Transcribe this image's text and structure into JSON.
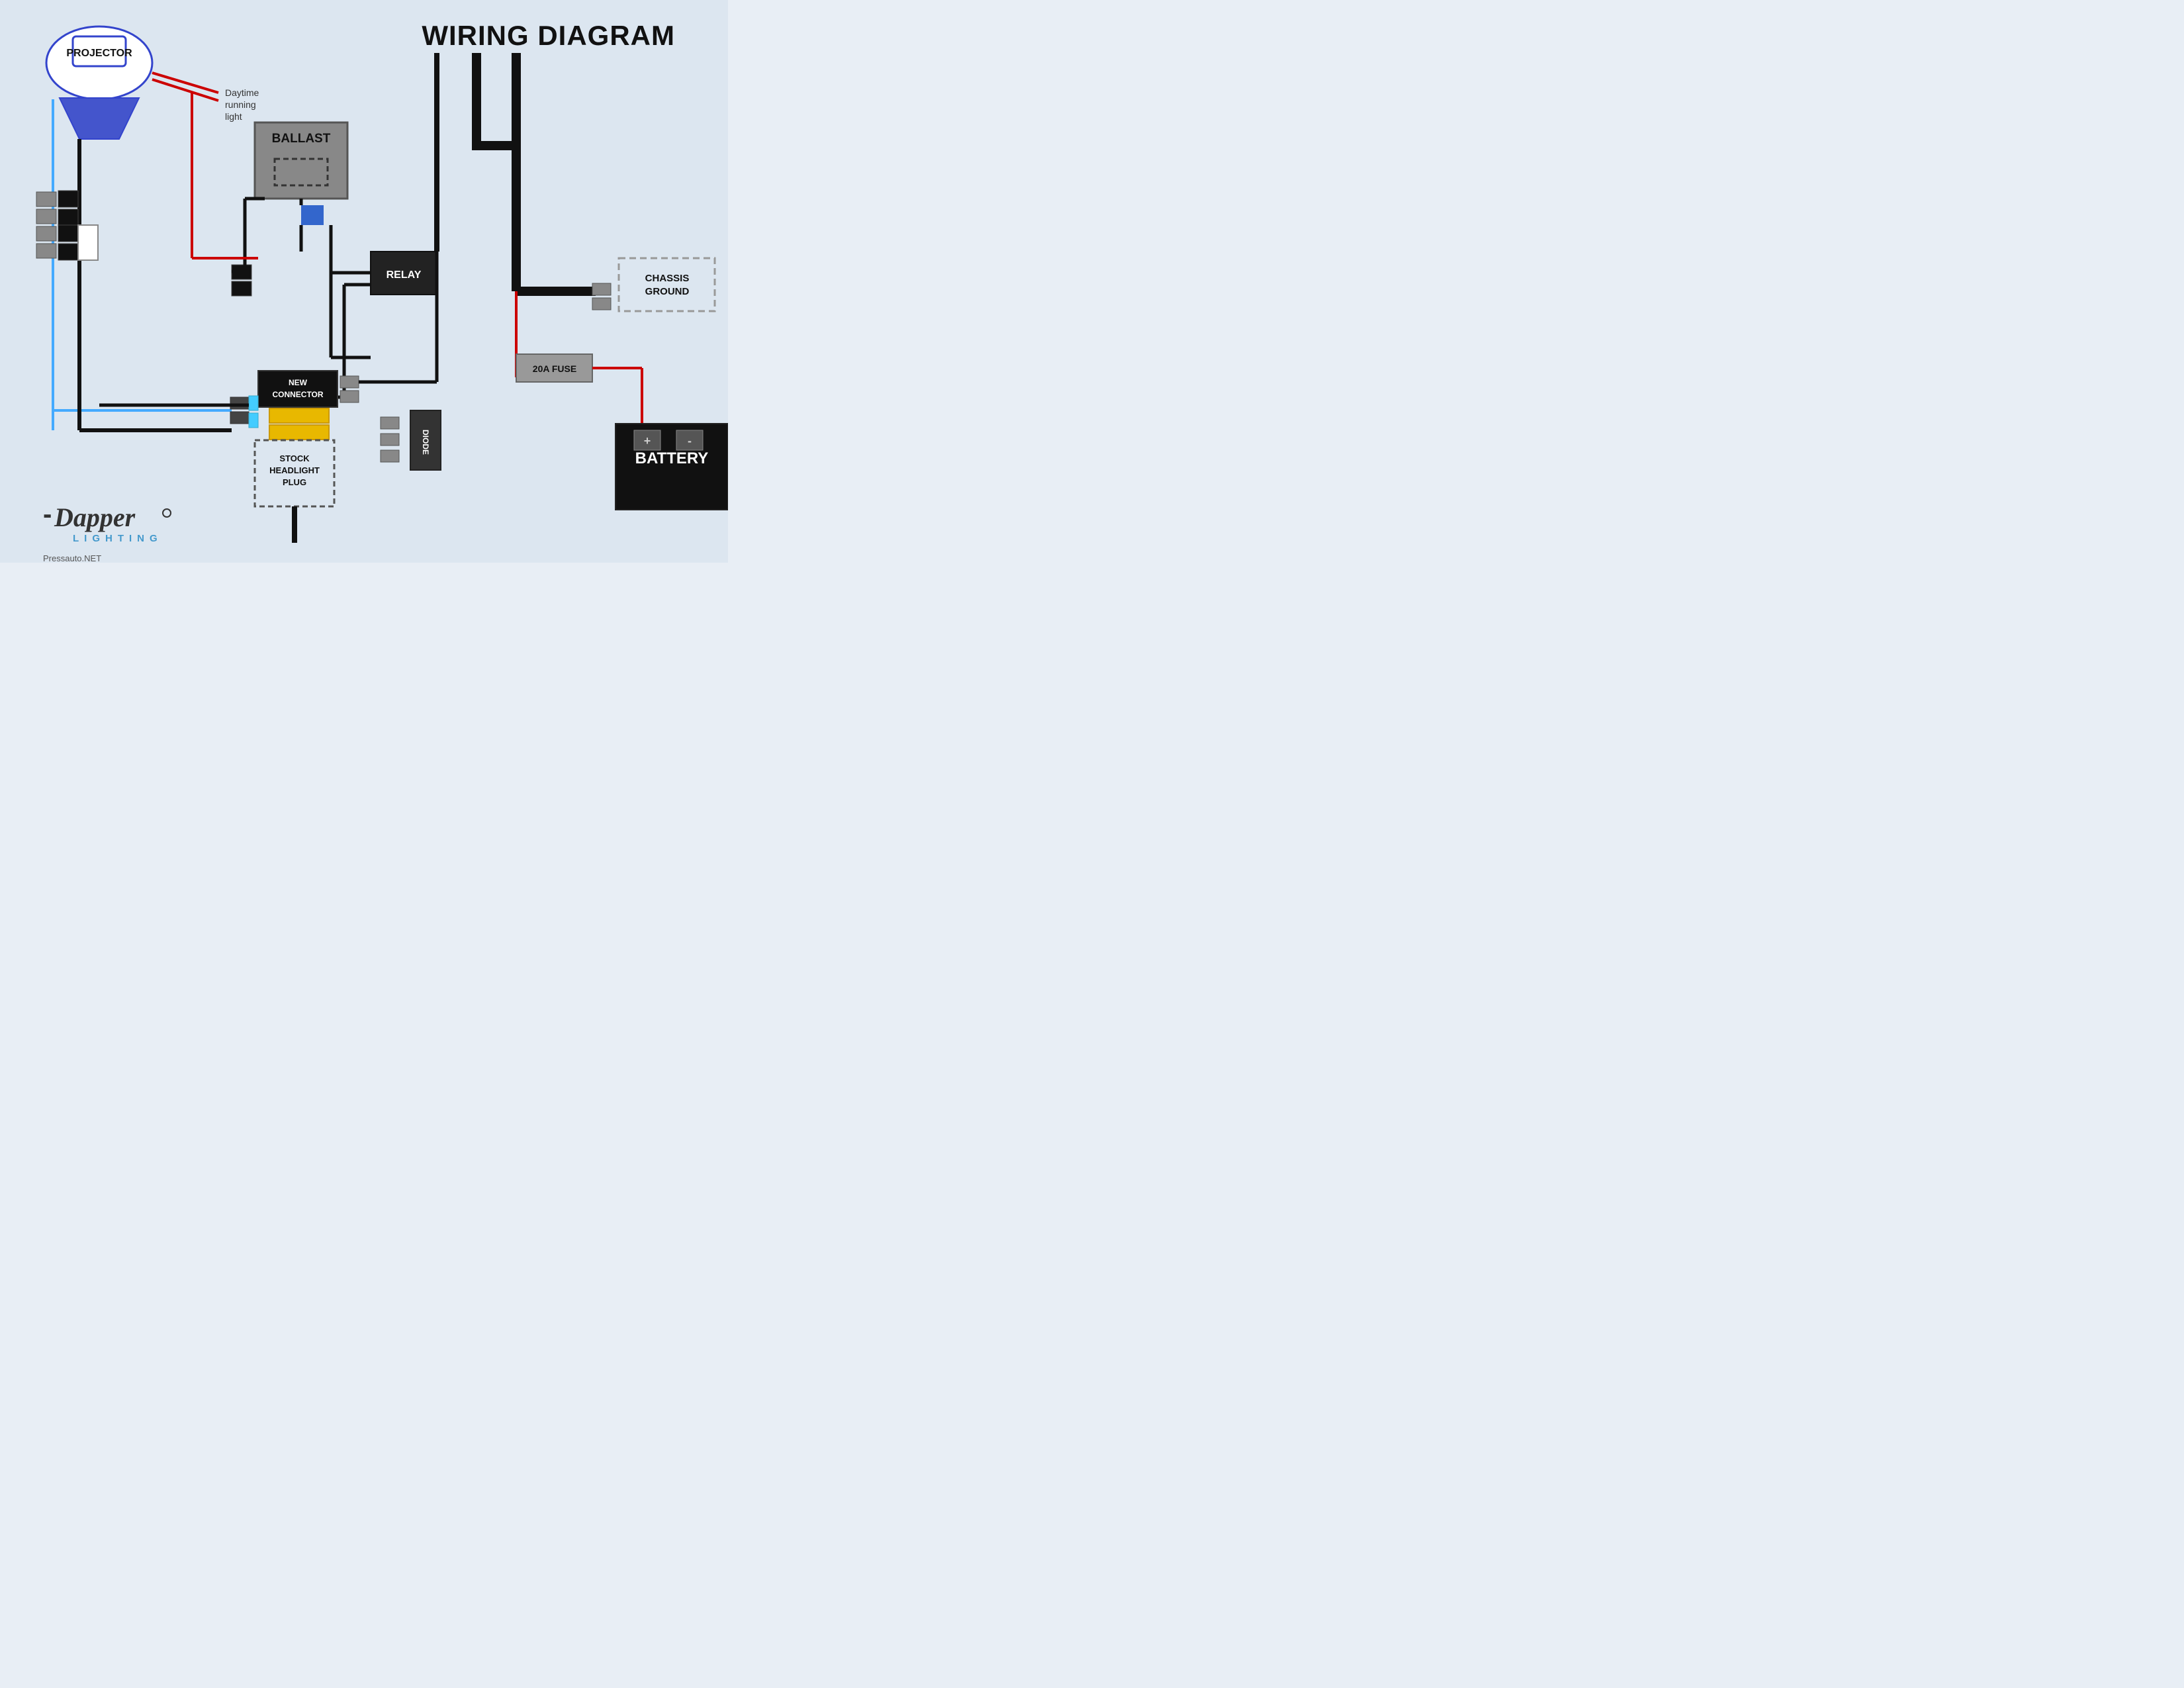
{
  "title": "WIRING DIAGRAM",
  "projector": {
    "label": "PROJECTOR"
  },
  "ballast": {
    "label": "BALLAST"
  },
  "relay": {
    "label": "RELAY"
  },
  "fuse": {
    "label": "20A FUSE"
  },
  "chassis_ground": {
    "label": "CHASSIS\nGROUND"
  },
  "battery": {
    "label": "BATTERY",
    "plus": "+",
    "minus": "-"
  },
  "new_connector": {
    "label": "NEW\nCONNECTOR"
  },
  "stock_plug": {
    "label": "STOCK\nHEADLIGHT\nPLUG"
  },
  "diode": {
    "label": "DIODE"
  },
  "drl": {
    "label": "Daytime\nrunning\nlight"
  },
  "logo": {
    "brand": "Dapper",
    "sub": "LIGHTING"
  },
  "footer": {
    "url": "Pressauto.NET"
  },
  "colors": {
    "red_wire": "#cc0000",
    "blue_wire": "#44aaff",
    "black_wire": "#111111",
    "yellow": "#e8b800",
    "gray": "#888888",
    "chassis_dashed": "#999999"
  }
}
